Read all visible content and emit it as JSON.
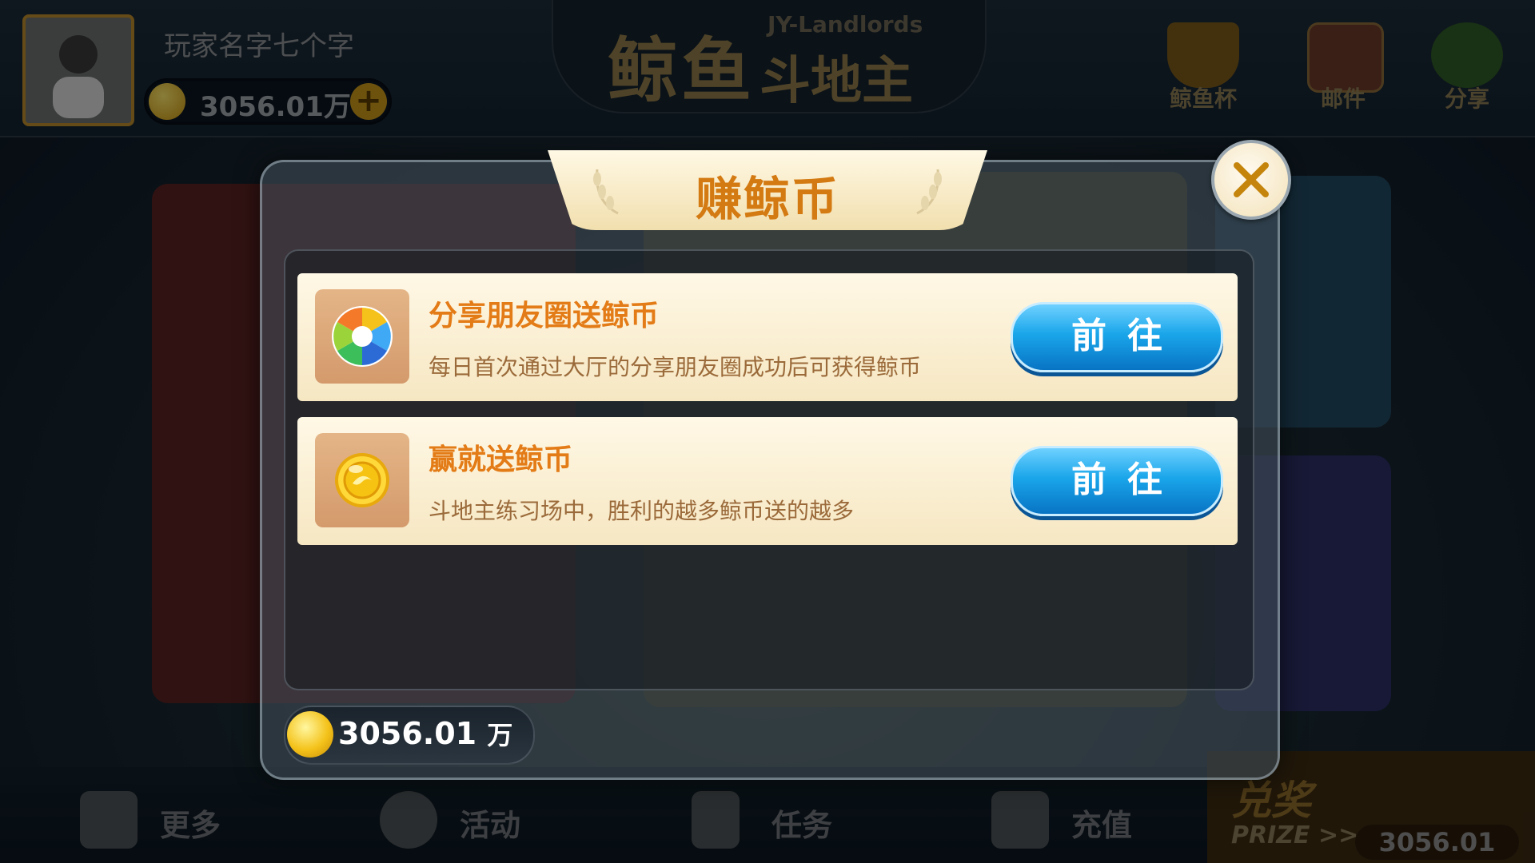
{
  "player": {
    "name": "玩家名字七个字",
    "coins": "3056.01万",
    "add_symbol": "+"
  },
  "logo": {
    "main": "鲸鱼",
    "sub": "斗地主",
    "english": "JY-Landlords"
  },
  "top_icons": [
    {
      "label": "鲸鱼杯",
      "icon": "trophy-icon"
    },
    {
      "label": "邮件",
      "icon": "mail-icon"
    },
    {
      "label": "分享",
      "icon": "wechat-icon"
    }
  ],
  "bottom_nav": [
    {
      "label": "更多",
      "icon": "grid-icon"
    },
    {
      "label": "活动",
      "icon": "activity-icon"
    },
    {
      "label": "任务",
      "icon": "task-icon"
    },
    {
      "label": "充值",
      "icon": "cart-icon"
    }
  ],
  "prize": {
    "title": "兑奖",
    "subtitle": "PRIZE >>",
    "value": "3056.01"
  },
  "modal": {
    "title": "赚鲸币",
    "tasks": [
      {
        "title": "分享朋友圈送鲸币",
        "description": "每日首次通过大厅的分享朋友圈成功后可获得鲸币",
        "button": "前往",
        "icon": "moments-icon"
      },
      {
        "title": "赢就送鲸币",
        "description": "斗地主练习场中，胜利的越多鲸币送的越多",
        "button": "前往",
        "icon": "coin-icon"
      }
    ],
    "balance_value": "3056.01",
    "balance_unit": "万"
  },
  "colors": {
    "accent_orange": "#e37b16",
    "button_blue": "#1aa6ea",
    "panel_cream": "#fff8e6"
  }
}
